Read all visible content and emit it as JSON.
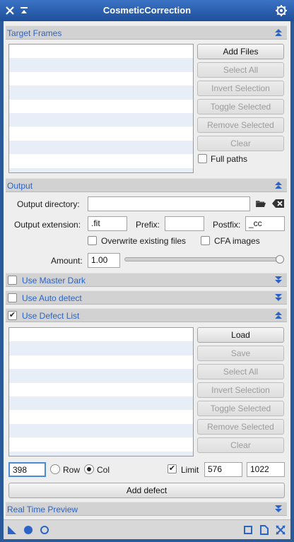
{
  "window": {
    "title": "CosmeticCorrection",
    "icons": {
      "close": "close-icon",
      "shade": "shade-icon",
      "settings": "gear-icon"
    }
  },
  "target_frames": {
    "title": "Target Frames",
    "buttons": {
      "add_files": "Add Files",
      "select_all": "Select All",
      "invert_selection": "Invert Selection",
      "toggle_selected": "Toggle Selected",
      "remove_selected": "Remove Selected",
      "clear": "Clear"
    },
    "full_paths_label": "Full paths",
    "full_paths_checked": false
  },
  "output": {
    "title": "Output",
    "directory_label": "Output directory:",
    "directory_value": "",
    "extension_label": "Output extension:",
    "extension_value": ".fit",
    "prefix_label": "Prefix:",
    "prefix_value": "",
    "postfix_label": "Postfix:",
    "postfix_value": "_cc",
    "overwrite_label": "Overwrite existing files",
    "overwrite_checked": false,
    "cfa_label": "CFA images",
    "cfa_checked": false,
    "amount_label": "Amount:",
    "amount_value": "1.00",
    "amount_fraction": 1.0
  },
  "master_dark": {
    "title": "Use Master Dark",
    "checked": false
  },
  "auto_detect": {
    "title": "Use Auto detect",
    "checked": false
  },
  "defect_list": {
    "title": "Use Defect List",
    "checked": true,
    "check_mark": "✔",
    "buttons": {
      "load": "Load",
      "save": "Save",
      "select_all": "Select All",
      "invert_selection": "Invert Selection",
      "toggle_selected": "Toggle Selected",
      "remove_selected": "Remove Selected",
      "clear": "Clear"
    },
    "coordinate_value": "398",
    "row_label": "Row",
    "row_selected": false,
    "col_label": "Col",
    "col_selected": true,
    "limit_label": "Limit",
    "limit_checked": true,
    "limit_from": "576",
    "limit_to": "1022",
    "add_defect_label": "Add defect"
  },
  "real_time_preview": {
    "title": "Real Time Preview"
  },
  "bottom_icons": [
    "new-instance-icon",
    "apply-global-icon",
    "reset-icon",
    "preview-icon",
    "document-icon",
    "maximize-icon"
  ],
  "colors": {
    "accent": "#2a64c8",
    "window_frame": "#2a5a9a"
  }
}
